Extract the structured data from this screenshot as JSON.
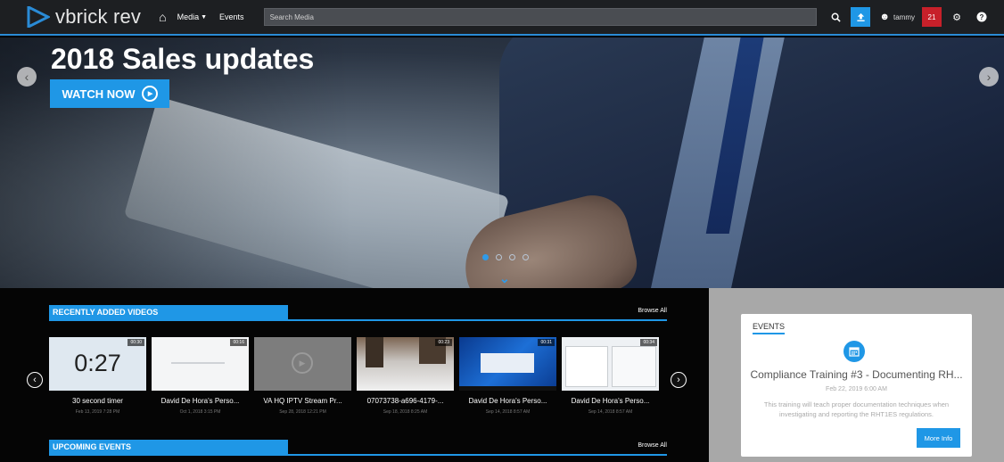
{
  "topbar": {
    "logo_text": "vbrick rev",
    "nav": {
      "media_label": "Media",
      "events_label": "Events"
    },
    "search_placeholder": "Search Media",
    "user_name": "tammy",
    "notifications_count": "21",
    "accent_color": "#1f97e6",
    "badge_color": "#c7202a"
  },
  "hero": {
    "title": "2018 Sales updates",
    "watch_label": "WATCH NOW",
    "slide_count": 4,
    "active_slide": 1
  },
  "recent": {
    "heading": "RECENTLY ADDED VIDEOS",
    "browse_label": "Browse All",
    "videos": [
      {
        "title": "30 second timer",
        "date": "Feb 13, 2019 7:28 PM",
        "duration": "00:30",
        "thumb_text": "0:27"
      },
      {
        "title": "David De Hora's Perso...",
        "date": "Oct 1, 2018 3:15 PM",
        "duration": "00:16"
      },
      {
        "title": "VA HQ IPTV Stream Pr...",
        "date": "Sep 28, 2018 12:21 PM",
        "duration": ""
      },
      {
        "title": "07073738-a696-4179-...",
        "date": "Sep 18, 2018 8:25 AM",
        "duration": "00:23"
      },
      {
        "title": "David De Hora's Perso...",
        "date": "Sep 14, 2018 8:57 AM",
        "duration": "00:31"
      },
      {
        "title": "David De Hora's Perso...",
        "date": "Sep 14, 2018 8:57 AM",
        "duration": "00:34"
      }
    ]
  },
  "upcoming": {
    "heading": "UPCOMING EVENTS",
    "browse_label": "Browse All"
  },
  "events_card": {
    "heading": "EVENTS",
    "title": "Compliance Training #3 - Documenting RH...",
    "date": "Feb 22, 2019 6:00 AM",
    "description": "This training will teach proper documentation techniques when investigating and reporting the RHT1ES regulations.",
    "more_label": "More Info"
  }
}
